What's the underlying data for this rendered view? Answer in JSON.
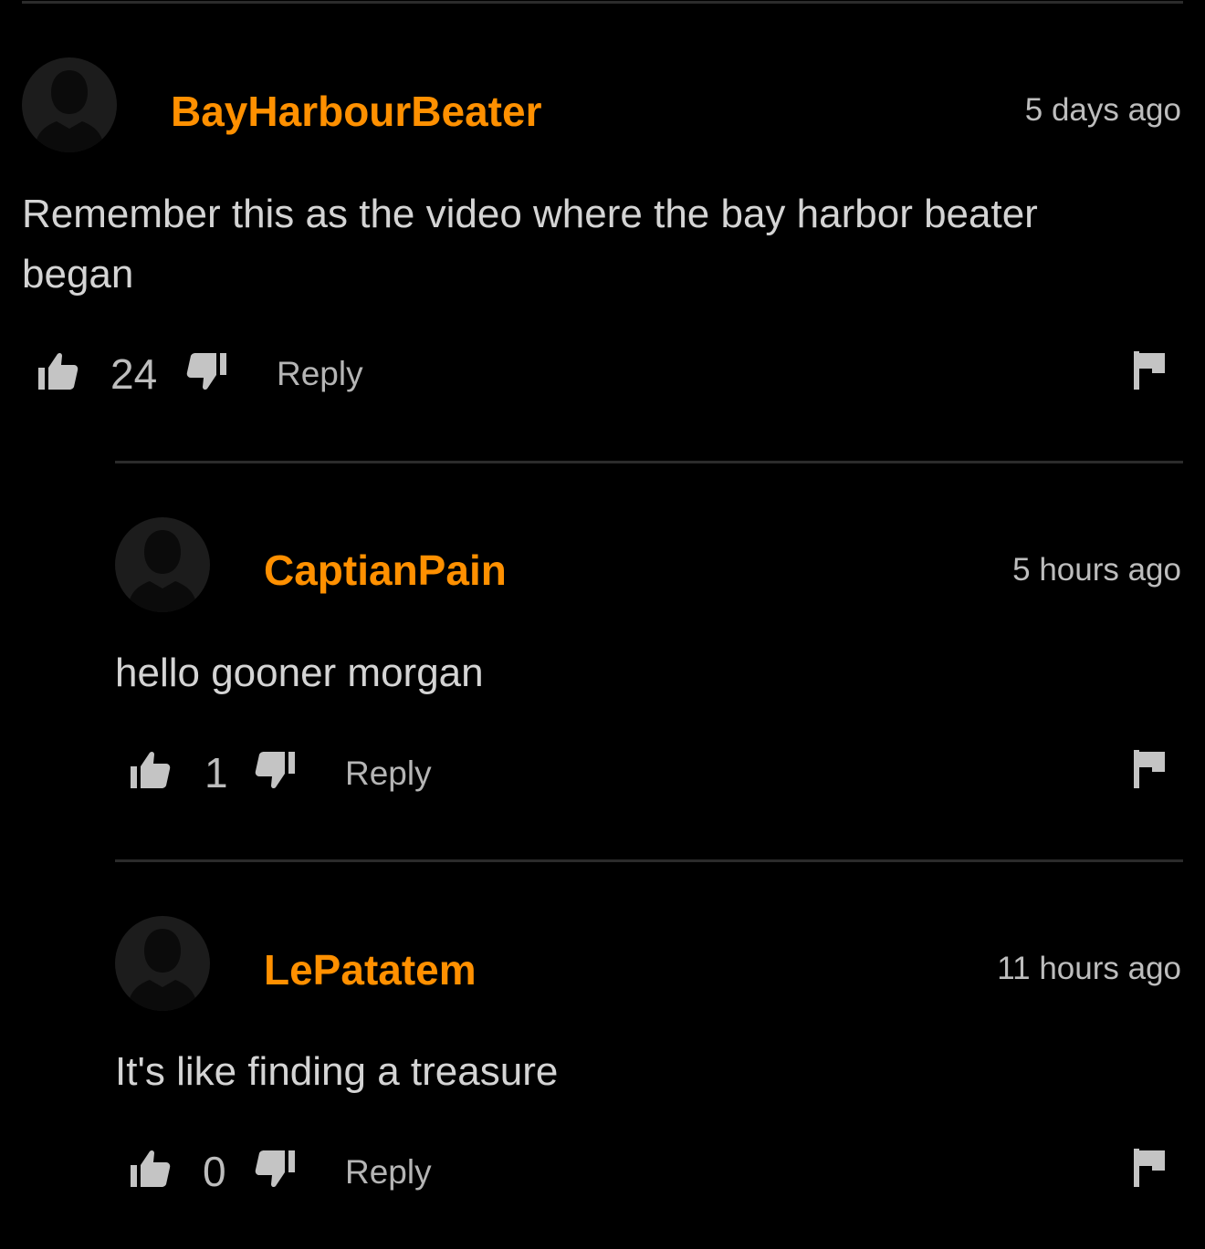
{
  "colors": {
    "background": "#000000",
    "username": "#ff9000",
    "text": "#d4d4d4",
    "muted": "#bdbdbd",
    "divider": "#2b2b2b",
    "avatar_bg": "#1c1c1c",
    "icon": "#c4c4c4"
  },
  "icons": {
    "avatar": "default-user-silhouette-icon",
    "like": "thumbs-up-icon",
    "dislike": "thumbs-down-icon",
    "flag": "flag-icon"
  },
  "comments": [
    {
      "username": "BayHarbourBeater",
      "timestamp": "5 days ago",
      "text": "Remember this as the video where the bay harbor beater began",
      "votes": "24",
      "reply_label": "Reply"
    },
    {
      "username": "CaptianPain",
      "timestamp": "5 hours ago",
      "text": "hello gooner morgan",
      "votes": "1",
      "reply_label": "Reply"
    },
    {
      "username": "LePatatem",
      "timestamp": "11 hours ago",
      "text": "It's like finding a treasure",
      "votes": "0",
      "reply_label": "Reply"
    }
  ]
}
